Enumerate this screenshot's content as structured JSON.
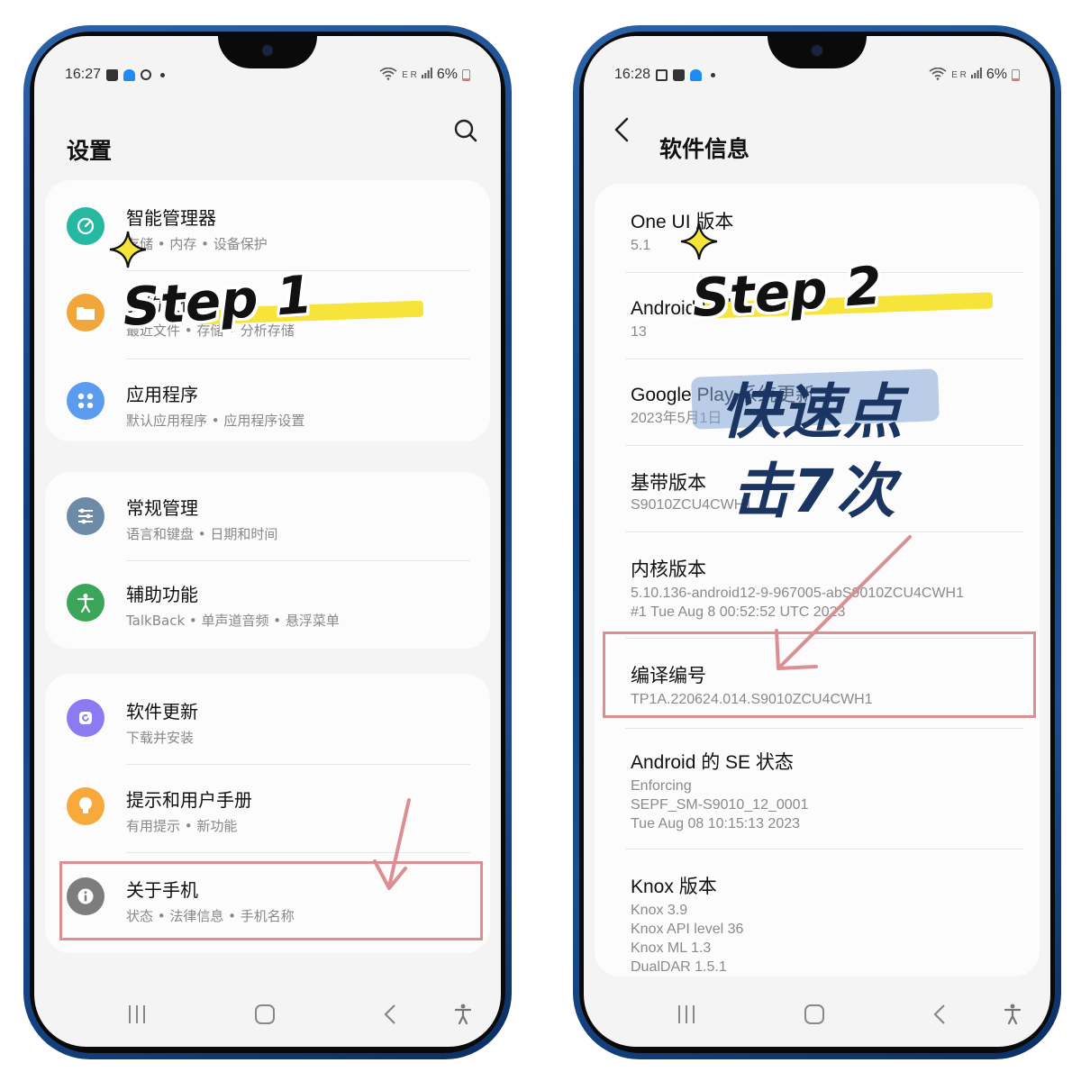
{
  "left_phone": {
    "status": {
      "time": "16:27",
      "battery": "6%",
      "network": "E R"
    },
    "header": {
      "title": "设置"
    },
    "groups": [
      {
        "items": [
          {
            "title": "智能管理器",
            "subtitle": "存储 • 内存 • 设备保护",
            "icon": "device-care-icon",
            "color": "#27b8a1"
          },
          {
            "title": "我的文件",
            "subtitle": "最近文件 • 存储 • 分析存储",
            "icon": "folder-icon",
            "color": "#f0a63a"
          },
          {
            "title": "应用程序",
            "subtitle": "默认应用程序 • 应用程序设置",
            "icon": "apps-icon",
            "color": "#5b9cf0"
          }
        ]
      },
      {
        "items": [
          {
            "title": "常规管理",
            "subtitle": "语言和键盘 • 日期和时间",
            "icon": "sliders-icon",
            "color": "#6d8aa6"
          },
          {
            "title": "辅助功能",
            "subtitle": "TalkBack • 单声道音频 • 悬浮菜单",
            "icon": "accessibility-icon",
            "color": "#3ba55a"
          }
        ]
      },
      {
        "items": [
          {
            "title": "软件更新",
            "subtitle": "下载并安装",
            "icon": "software-update-icon",
            "color": "#8a7bf2"
          },
          {
            "title": "提示和用户手册",
            "subtitle": "有用提示 • 新功能",
            "icon": "lightbulb-icon",
            "color": "#f7a93b"
          },
          {
            "title": "关于手机",
            "subtitle": "状态 • 法律信息 • 手机名称",
            "icon": "info-icon",
            "color": "#7d7d7d"
          }
        ]
      }
    ],
    "annotation": {
      "step": "Step 1"
    }
  },
  "right_phone": {
    "status": {
      "time": "16:28",
      "battery": "6%",
      "network": "E R"
    },
    "header": {
      "title": "软件信息"
    },
    "items": [
      {
        "title": "One UI 版本",
        "lines": [
          "5.1"
        ]
      },
      {
        "title": "Android 版本",
        "lines": [
          "13"
        ]
      },
      {
        "title": "Google Play 系统更新",
        "lines": [
          "2023年5月1日"
        ]
      },
      {
        "title": "基带版本",
        "lines": [
          "S9010ZCU4CWH1"
        ]
      },
      {
        "title": "内核版本",
        "lines": [
          "5.10.136-android12-9-967005-abS9010ZCU4CWH1",
          "#1 Tue Aug 8 00:52:52 UTC 2023"
        ]
      },
      {
        "title": "编译编号",
        "lines": [
          "TP1A.220624.014.S9010ZCU4CWH1"
        ]
      },
      {
        "title": "Android 的 SE 状态",
        "lines": [
          "Enforcing",
          "SEPF_SM-S9010_12_0001",
          "Tue Aug 08 10:15:13 2023"
        ]
      },
      {
        "title": "Knox 版本",
        "lines": [
          "Knox 3.9",
          "Knox API level 36",
          "Knox ML 1.3",
          "DualDAR 1.5.1"
        ]
      }
    ],
    "annotation": {
      "step": "Step 2",
      "tap_line1": "快速点",
      "tap_line2": "击7次"
    }
  },
  "colors": {
    "highlight": "#dc8e93",
    "marker_yellow": "#f7e43a",
    "phone_frame": "#1b4f92"
  }
}
